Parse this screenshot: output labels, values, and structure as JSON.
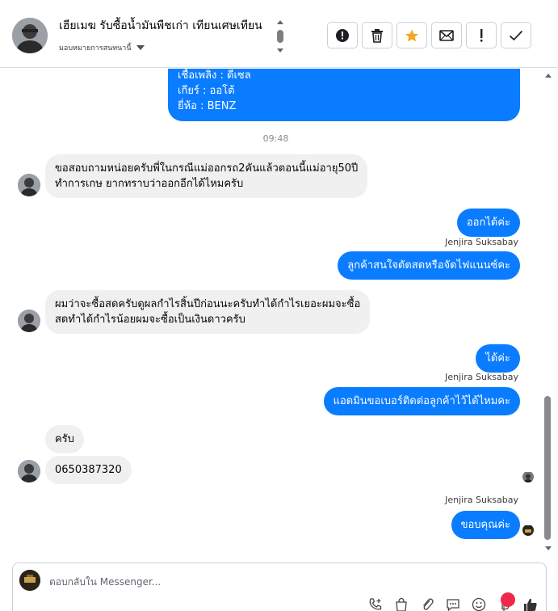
{
  "header": {
    "title": "เฮียเมฆ รับซื้อน้ำมันพืชเก่า เทียนเศษเทียน",
    "subtitle": "มอบหมายการสนทนานี้"
  },
  "toolbar": {
    "spam_icon": "exclamation-circle-icon",
    "delete_icon": "trash-icon",
    "star_icon": "star-icon",
    "mail_icon": "envelope-icon",
    "follow_up_icon": "exclamation-icon",
    "done_icon": "check-icon",
    "accent": "#f5a623"
  },
  "messages": {
    "m0": {
      "line1": "เชื้อเพลิง : ดีเซล",
      "line2": "เกียร์ : ออโต้",
      "line3": "ยี่ห้อ : BENZ"
    },
    "time": "09:48",
    "m1": {
      "line1": "ขอสอบถามหน่อยครับพี่ในกรณีแม่ออกรถ2คันแล้วตอนนี้แม่อายุ50ปี",
      "line2": "ทำการเกษ ยากทราบว่าออกอีกได้ไหมครับ"
    },
    "m2": "ออกได้ค่ะ",
    "sender1": "Jenjira Suksabay",
    "m3": "ลูกค้าสนใจตัดสดหรือจัดไฟแนนซ์คะ",
    "m4": {
      "line1": "ผมว่าจะซื้อสดครับดูผลกำไรสิ้นปีก่อนนะครับทำได้กำไรเยอะผมจะซื้อ",
      "line2": "สดทำได้กำไรน้อยผมจะซื้อเป็นเงินดาวครับ"
    },
    "m5": "ได้ค่ะ",
    "sender2": "Jenjira Suksabay",
    "m6": "แอดมินขอเบอร์ติดต่อลูกค้าไว้ได้ไหมคะ",
    "m7": "ครับ",
    "m8": "0650387320",
    "sender3": "Jenjira Suksabay",
    "m9": "ขอบคุณค่ะ"
  },
  "composer": {
    "placeholder": "ตอบกลับใน Messenger..."
  },
  "colors": {
    "outgoing": "#0a7cff",
    "incoming": "#f0f0f0",
    "notification": "#f02849"
  }
}
